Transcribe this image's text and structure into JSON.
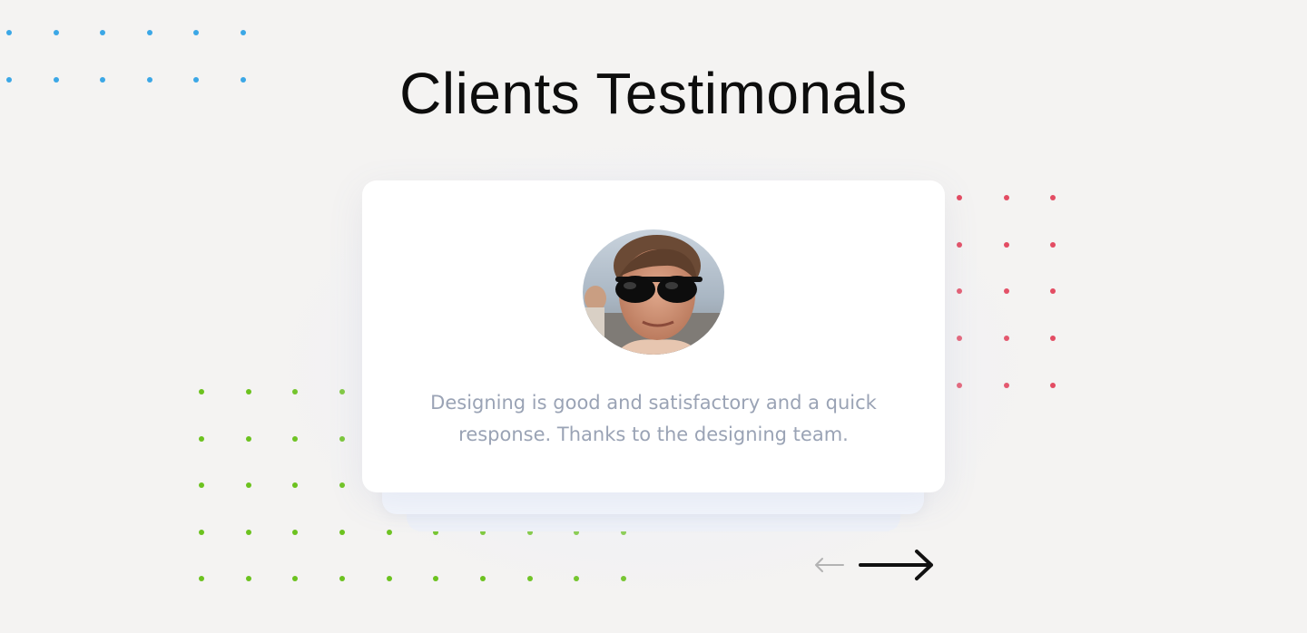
{
  "section": {
    "title": "Clients Testimonals"
  },
  "testimonial": {
    "avatar_alt": "client avatar",
    "quote": "Designing is good and satisfactory and a quick response. Thanks to the designing team."
  },
  "navigation": {
    "prev_icon": "arrow-left-icon",
    "next_icon": "arrow-right-icon"
  },
  "decoration": {
    "dot_colors": {
      "blue": "#3ba7e6",
      "red": "#e34c63",
      "green": "#6cc21f"
    }
  }
}
